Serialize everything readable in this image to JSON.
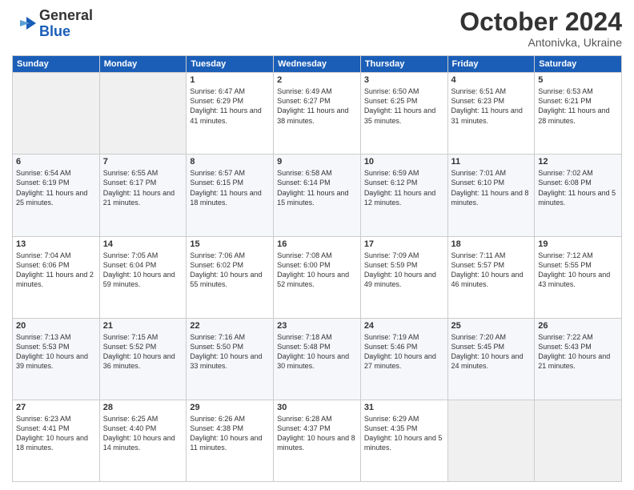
{
  "header": {
    "logo_general": "General",
    "logo_blue": "Blue",
    "month": "October 2024",
    "location": "Antonivka, Ukraine"
  },
  "weekdays": [
    "Sunday",
    "Monday",
    "Tuesday",
    "Wednesday",
    "Thursday",
    "Friday",
    "Saturday"
  ],
  "weeks": [
    [
      {
        "day": "",
        "sunrise": "",
        "sunset": "",
        "daylight": ""
      },
      {
        "day": "",
        "sunrise": "",
        "sunset": "",
        "daylight": ""
      },
      {
        "day": "1",
        "sunrise": "Sunrise: 6:47 AM",
        "sunset": "Sunset: 6:29 PM",
        "daylight": "Daylight: 11 hours and 41 minutes."
      },
      {
        "day": "2",
        "sunrise": "Sunrise: 6:49 AM",
        "sunset": "Sunset: 6:27 PM",
        "daylight": "Daylight: 11 hours and 38 minutes."
      },
      {
        "day": "3",
        "sunrise": "Sunrise: 6:50 AM",
        "sunset": "Sunset: 6:25 PM",
        "daylight": "Daylight: 11 hours and 35 minutes."
      },
      {
        "day": "4",
        "sunrise": "Sunrise: 6:51 AM",
        "sunset": "Sunset: 6:23 PM",
        "daylight": "Daylight: 11 hours and 31 minutes."
      },
      {
        "day": "5",
        "sunrise": "Sunrise: 6:53 AM",
        "sunset": "Sunset: 6:21 PM",
        "daylight": "Daylight: 11 hours and 28 minutes."
      }
    ],
    [
      {
        "day": "6",
        "sunrise": "Sunrise: 6:54 AM",
        "sunset": "Sunset: 6:19 PM",
        "daylight": "Daylight: 11 hours and 25 minutes."
      },
      {
        "day": "7",
        "sunrise": "Sunrise: 6:55 AM",
        "sunset": "Sunset: 6:17 PM",
        "daylight": "Daylight: 11 hours and 21 minutes."
      },
      {
        "day": "8",
        "sunrise": "Sunrise: 6:57 AM",
        "sunset": "Sunset: 6:15 PM",
        "daylight": "Daylight: 11 hours and 18 minutes."
      },
      {
        "day": "9",
        "sunrise": "Sunrise: 6:58 AM",
        "sunset": "Sunset: 6:14 PM",
        "daylight": "Daylight: 11 hours and 15 minutes."
      },
      {
        "day": "10",
        "sunrise": "Sunrise: 6:59 AM",
        "sunset": "Sunset: 6:12 PM",
        "daylight": "Daylight: 11 hours and 12 minutes."
      },
      {
        "day": "11",
        "sunrise": "Sunrise: 7:01 AM",
        "sunset": "Sunset: 6:10 PM",
        "daylight": "Daylight: 11 hours and 8 minutes."
      },
      {
        "day": "12",
        "sunrise": "Sunrise: 7:02 AM",
        "sunset": "Sunset: 6:08 PM",
        "daylight": "Daylight: 11 hours and 5 minutes."
      }
    ],
    [
      {
        "day": "13",
        "sunrise": "Sunrise: 7:04 AM",
        "sunset": "Sunset: 6:06 PM",
        "daylight": "Daylight: 11 hours and 2 minutes."
      },
      {
        "day": "14",
        "sunrise": "Sunrise: 7:05 AM",
        "sunset": "Sunset: 6:04 PM",
        "daylight": "Daylight: 10 hours and 59 minutes."
      },
      {
        "day": "15",
        "sunrise": "Sunrise: 7:06 AM",
        "sunset": "Sunset: 6:02 PM",
        "daylight": "Daylight: 10 hours and 55 minutes."
      },
      {
        "day": "16",
        "sunrise": "Sunrise: 7:08 AM",
        "sunset": "Sunset: 6:00 PM",
        "daylight": "Daylight: 10 hours and 52 minutes."
      },
      {
        "day": "17",
        "sunrise": "Sunrise: 7:09 AM",
        "sunset": "Sunset: 5:59 PM",
        "daylight": "Daylight: 10 hours and 49 minutes."
      },
      {
        "day": "18",
        "sunrise": "Sunrise: 7:11 AM",
        "sunset": "Sunset: 5:57 PM",
        "daylight": "Daylight: 10 hours and 46 minutes."
      },
      {
        "day": "19",
        "sunrise": "Sunrise: 7:12 AM",
        "sunset": "Sunset: 5:55 PM",
        "daylight": "Daylight: 10 hours and 43 minutes."
      }
    ],
    [
      {
        "day": "20",
        "sunrise": "Sunrise: 7:13 AM",
        "sunset": "Sunset: 5:53 PM",
        "daylight": "Daylight: 10 hours and 39 minutes."
      },
      {
        "day": "21",
        "sunrise": "Sunrise: 7:15 AM",
        "sunset": "Sunset: 5:52 PM",
        "daylight": "Daylight: 10 hours and 36 minutes."
      },
      {
        "day": "22",
        "sunrise": "Sunrise: 7:16 AM",
        "sunset": "Sunset: 5:50 PM",
        "daylight": "Daylight: 10 hours and 33 minutes."
      },
      {
        "day": "23",
        "sunrise": "Sunrise: 7:18 AM",
        "sunset": "Sunset: 5:48 PM",
        "daylight": "Daylight: 10 hours and 30 minutes."
      },
      {
        "day": "24",
        "sunrise": "Sunrise: 7:19 AM",
        "sunset": "Sunset: 5:46 PM",
        "daylight": "Daylight: 10 hours and 27 minutes."
      },
      {
        "day": "25",
        "sunrise": "Sunrise: 7:20 AM",
        "sunset": "Sunset: 5:45 PM",
        "daylight": "Daylight: 10 hours and 24 minutes."
      },
      {
        "day": "26",
        "sunrise": "Sunrise: 7:22 AM",
        "sunset": "Sunset: 5:43 PM",
        "daylight": "Daylight: 10 hours and 21 minutes."
      }
    ],
    [
      {
        "day": "27",
        "sunrise": "Sunrise: 6:23 AM",
        "sunset": "Sunset: 4:41 PM",
        "daylight": "Daylight: 10 hours and 18 minutes."
      },
      {
        "day": "28",
        "sunrise": "Sunrise: 6:25 AM",
        "sunset": "Sunset: 4:40 PM",
        "daylight": "Daylight: 10 hours and 14 minutes."
      },
      {
        "day": "29",
        "sunrise": "Sunrise: 6:26 AM",
        "sunset": "Sunset: 4:38 PM",
        "daylight": "Daylight: 10 hours and 11 minutes."
      },
      {
        "day": "30",
        "sunrise": "Sunrise: 6:28 AM",
        "sunset": "Sunset: 4:37 PM",
        "daylight": "Daylight: 10 hours and 8 minutes."
      },
      {
        "day": "31",
        "sunrise": "Sunrise: 6:29 AM",
        "sunset": "Sunset: 4:35 PM",
        "daylight": "Daylight: 10 hours and 5 minutes."
      },
      {
        "day": "",
        "sunrise": "",
        "sunset": "",
        "daylight": ""
      },
      {
        "day": "",
        "sunrise": "",
        "sunset": "",
        "daylight": ""
      }
    ]
  ]
}
